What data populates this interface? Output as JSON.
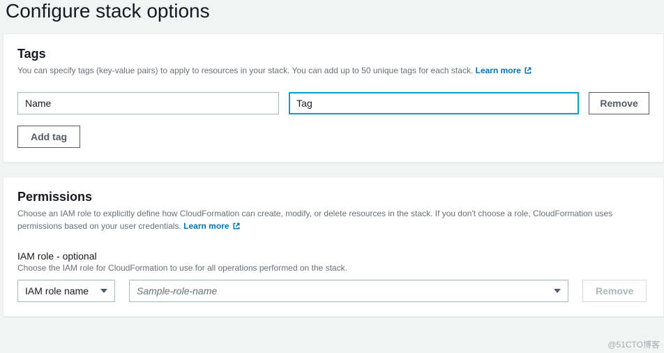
{
  "page": {
    "title": "Configure stack options"
  },
  "tags": {
    "title": "Tags",
    "description": "You can specify tags (key-value pairs) to apply to resources in your stack. You can add up to 50 unique tags for each stack.",
    "learn_more": "Learn more",
    "key_value": "Name",
    "value_value": "Tag",
    "remove_label": "Remove",
    "add_tag_label": "Add tag"
  },
  "permissions": {
    "title": "Permissions",
    "description": "Choose an IAM role to explicitly define how CloudFormation can create, modify, or delete resources in the stack. If you don't choose a role, CloudFormation uses permissions based on your user credentials.",
    "learn_more": "Learn more",
    "role_label": "IAM role - optional",
    "role_hint": "Choose the IAM role for CloudFormation to use for all operations performed on the stack.",
    "role_type_selected": "IAM role name",
    "role_placeholder": "Sample-role-name",
    "remove_label": "Remove"
  },
  "watermark": "@51CTO博客"
}
